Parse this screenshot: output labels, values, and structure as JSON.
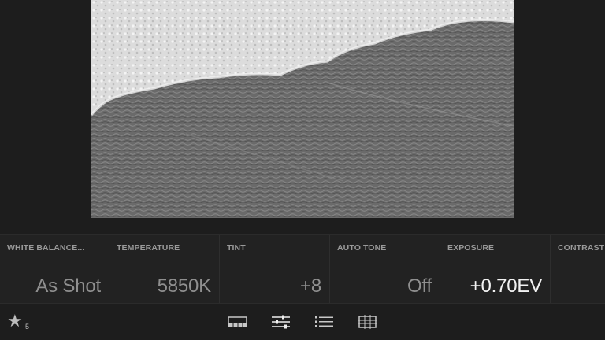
{
  "photo": {
    "description_icon": "photo-icon"
  },
  "adjustments": [
    {
      "label": "WHITE BALANCE...",
      "value": "As Shot",
      "active": false
    },
    {
      "label": "TEMPERATURE",
      "value": "5850K",
      "active": false
    },
    {
      "label": "TINT",
      "value": "+8",
      "active": false
    },
    {
      "label": "AUTO TONE",
      "value": "Off",
      "active": false
    },
    {
      "label": "EXPOSURE",
      "value": "+0.70EV",
      "active": true
    },
    {
      "label": "CONTRAST",
      "value": "",
      "active": false
    }
  ],
  "bottom_bar": {
    "rating_icon": "star-icon",
    "rating_count": "5",
    "tools": [
      "filmstrip-icon",
      "sliders-icon",
      "list-icon",
      "crop-grid-icon"
    ]
  },
  "colors": {
    "background": "#1d1d1d",
    "value_active": "#f2f2f2",
    "value_dim": "#8f8f8f",
    "label": "#9a9a9a"
  }
}
